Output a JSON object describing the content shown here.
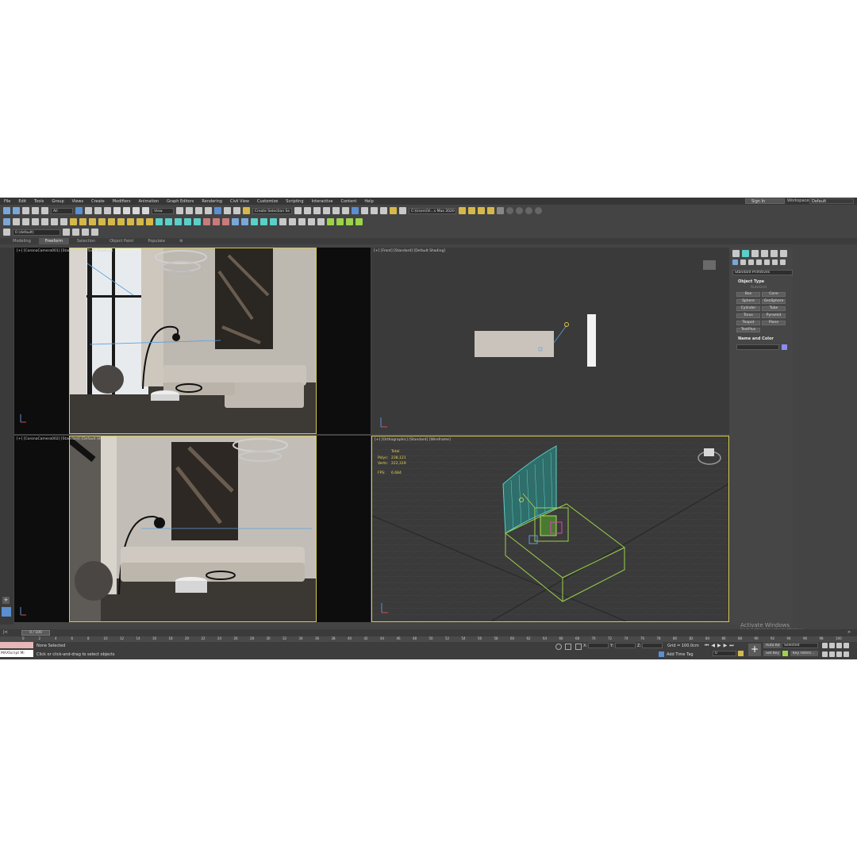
{
  "menu": [
    "File",
    "Edit",
    "Tools",
    "Group",
    "Views",
    "Create",
    "Modifiers",
    "Animation",
    "Graph Editors",
    "Rendering",
    "Civil View",
    "Customize",
    "Scripting",
    "Interactive",
    "Content",
    "Help"
  ],
  "header": {
    "sign_in": "Sign In",
    "workspaces_label": "Workspaces:",
    "workspaces_value": "Default"
  },
  "toolbar": {
    "filter_value": "All",
    "view_value": "View",
    "selection_set_value": "Create Selection Se",
    "path_value": "C:\\Users\\Vi...s Max 2020",
    "layer_value": "0 (default)"
  },
  "ribbon": {
    "tabs": [
      "Modeling",
      "Freeform",
      "Selection",
      "Object Paint",
      "Populate"
    ],
    "active_tab": "Freeform"
  },
  "viewports": {
    "top_left": "[+] [CoronaCamera001] [Standard] [Default Shading]",
    "top_right": "[+] [Front] [Standard] [Default Shading]",
    "bottom_left": "[+] [CoronaCamera002] [Standard] [Default Shading]",
    "bottom_right": "[+] [Orthographic] [Standard] [Wireframe]"
  },
  "stats": {
    "total_label": "Total",
    "polys_label": "Polys:",
    "polys_value": "238,121",
    "verts_label": "Verts:",
    "verts_value": "222,319",
    "fps_label": "FPS:",
    "fps_value": "6.684"
  },
  "command_panel": {
    "dropdown": "Standard Primitives",
    "object_type_title": "Object Type",
    "autogrid": "AutoGrid",
    "buttons": [
      "Box",
      "Cone",
      "Sphere",
      "GeoSphere",
      "Cylinder",
      "Tube",
      "Torus",
      "Pyramid",
      "Teapot",
      "Plane",
      "TextPlus"
    ],
    "name_color_title": "Name and Color",
    "swatch_color": "#8c8cf0"
  },
  "timeline": {
    "frame_label": "0 / 100",
    "ticks": [
      "0",
      "2",
      "4",
      "6",
      "8",
      "10",
      "12",
      "14",
      "16",
      "18",
      "20",
      "22",
      "24",
      "26",
      "28",
      "30",
      "32",
      "34",
      "36",
      "38",
      "40",
      "42",
      "44",
      "46",
      "48",
      "50",
      "52",
      "54",
      "56",
      "58",
      "60",
      "62",
      "64",
      "66",
      "68",
      "70",
      "72",
      "74",
      "76",
      "78",
      "80",
      "82",
      "84",
      "86",
      "88",
      "90",
      "92",
      "94",
      "96",
      "98",
      "100"
    ]
  },
  "status": {
    "maxscript": "MAXScript Mi",
    "selection": "None Selected",
    "prompt": "Click or click-and-drag to select objects",
    "x_label": "X:",
    "y_label": "Y:",
    "z_label": "Z:",
    "grid": "Grid = 100.0cm",
    "add_time_tag": "Add Time Tag",
    "auto_key": "Auto Key",
    "set_key": "Set Key",
    "selected": "Selected",
    "key_filters": "Key Filters...",
    "frame_field": "0"
  },
  "watermark": {
    "title": "Activate Windows",
    "subtitle": "Go to Settings to activate Windows."
  },
  "colors": {
    "viewport_active": "#d6c84a",
    "wireframe_green": "#9cd34a",
    "wireframe_cyan": "#5ad0c8",
    "accent_blue": "#4a8fd6"
  }
}
